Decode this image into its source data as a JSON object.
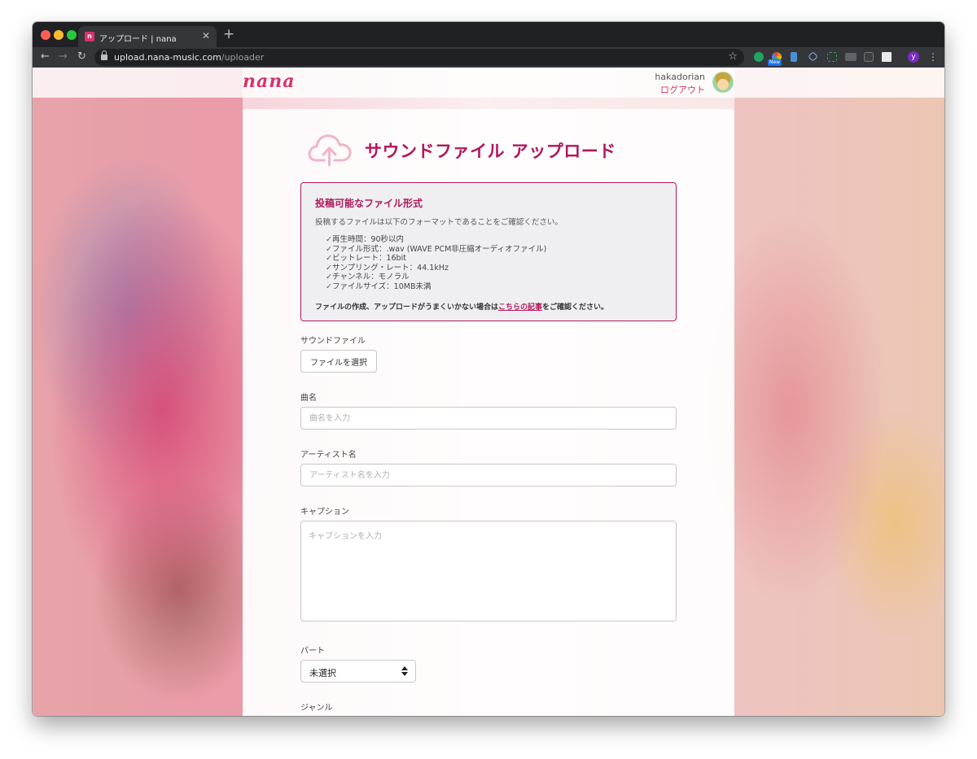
{
  "browser": {
    "tab_title": "アップロード | nana",
    "tab_favicon": "n",
    "new_tab_glyph": "+",
    "url_host": "upload.nana-music.com",
    "url_path": "/uploader",
    "ext_badge": "New",
    "profile_initial": "y",
    "icons": [
      "back-arrow-icon",
      "forward-arrow-icon",
      "reload-icon",
      "lock-icon",
      "star-icon",
      "menu-dots-icon"
    ]
  },
  "header": {
    "logo": "nana",
    "username": "hakadorian",
    "logout": "ログアウト"
  },
  "upload": {
    "title": "サウンドファイル アップロード",
    "info": {
      "title": "投稿可能なファイル形式",
      "description": "投稿するファイルは以下のフォーマットであることをご確認ください。",
      "requirements": [
        "再生時間：90秒以内",
        "ファイル形式：.wav (WAVE PCM非圧縮オーディオファイル)",
        "ビットレート：16bit",
        "サンプリング・レート：44.1kHz",
        "チャンネル：モノラル",
        "ファイルサイズ：10MB未満"
      ],
      "note_before": "ファイルの作成、アップロードがうまくいかない場合は",
      "note_link": "こちらの記事",
      "note_after": "をご確認ください。"
    },
    "sound_file": {
      "label": "サウンドファイル",
      "button": "ファイルを選択"
    },
    "song": {
      "label": "曲名",
      "placeholder": "曲名を入力",
      "value": ""
    },
    "artist": {
      "label": "アーティスト名",
      "placeholder": "アーティスト名を入力",
      "value": ""
    },
    "caption": {
      "label": "キャプション",
      "placeholder": "キャプションを入力",
      "value": ""
    },
    "part": {
      "label": "パート",
      "selected": "未選択"
    },
    "genre": {
      "label": "ジャンル"
    }
  },
  "colors": {
    "accent": "#b0185c",
    "brand": "#d6336c"
  }
}
